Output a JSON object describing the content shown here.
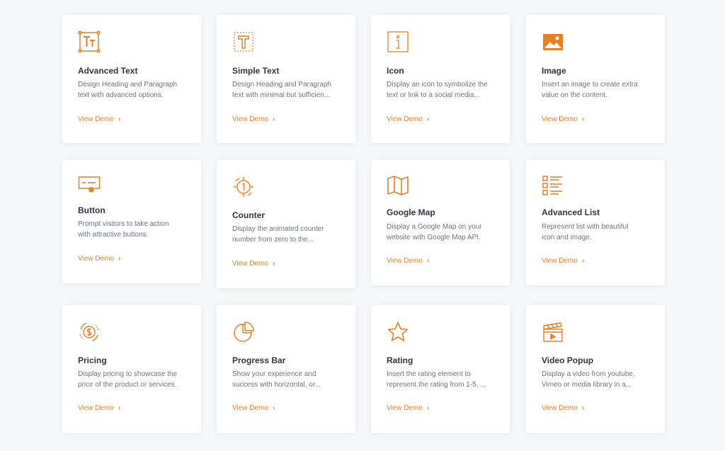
{
  "theme": {
    "accent": "#e67e22",
    "title_color": "#2f3541",
    "text_color": "#6b7280",
    "background": "#f5f6f8"
  },
  "cards": [
    {
      "title": "Advanced Text",
      "desc": [
        "Design Heading and Paragraph",
        "text with advanced options."
      ],
      "link": "View Demo",
      "icon": "advanced-text-icon"
    },
    {
      "title": "Simple Text",
      "desc": [
        "Design Heading and Paragraph",
        "text with minimal but sufficien..."
      ],
      "link": "View Demo",
      "icon": "simple-text-icon"
    },
    {
      "title": "Icon",
      "desc": [
        "Display an icon to symbolize the",
        "text or link to a social media..."
      ],
      "link": "View Demo",
      "icon": "info-icon"
    },
    {
      "title": "Image",
      "desc": [
        "Insert an image to create extra",
        "value on the content."
      ],
      "link": "View Demo",
      "icon": "image-icon"
    },
    {
      "title": "Button",
      "desc": [
        "Prompt visitors to take action",
        "with attractive buttons."
      ],
      "link": "View Demo",
      "icon": "button-icon"
    },
    {
      "title": "Counter",
      "desc": [
        "Display the animated counter",
        "number from zero to the..."
      ],
      "link": "View Demo",
      "icon": "counter-icon"
    },
    {
      "title": "Google Map",
      "desc": [
        "Display a Google Map on your",
        "website with Google Map API."
      ],
      "link": "View Demo",
      "icon": "map-icon"
    },
    {
      "title": "Advanced List",
      "desc": [
        "Represent list with beautiful",
        "icon and image."
      ],
      "link": "View Demo",
      "icon": "list-icon"
    },
    {
      "title": "Pricing",
      "desc": [
        "Display pricing to showcase the",
        "price of the product or services."
      ],
      "link": "View Demo",
      "icon": "pricing-icon"
    },
    {
      "title": "Progress Bar",
      "desc": [
        "Show your experience and",
        "success with horizontal, or..."
      ],
      "link": "View Demo",
      "icon": "progress-bar-icon"
    },
    {
      "title": "Rating",
      "desc": [
        "Insert the rating element to",
        "represent the rating from 1-5, ..."
      ],
      "link": "View Demo",
      "icon": "star-icon"
    },
    {
      "title": "Video Popup",
      "desc": [
        "Display a video from youtube,",
        "Vimeo or media library in a..."
      ],
      "link": "View Demo",
      "icon": "clapperboard-icon"
    }
  ]
}
